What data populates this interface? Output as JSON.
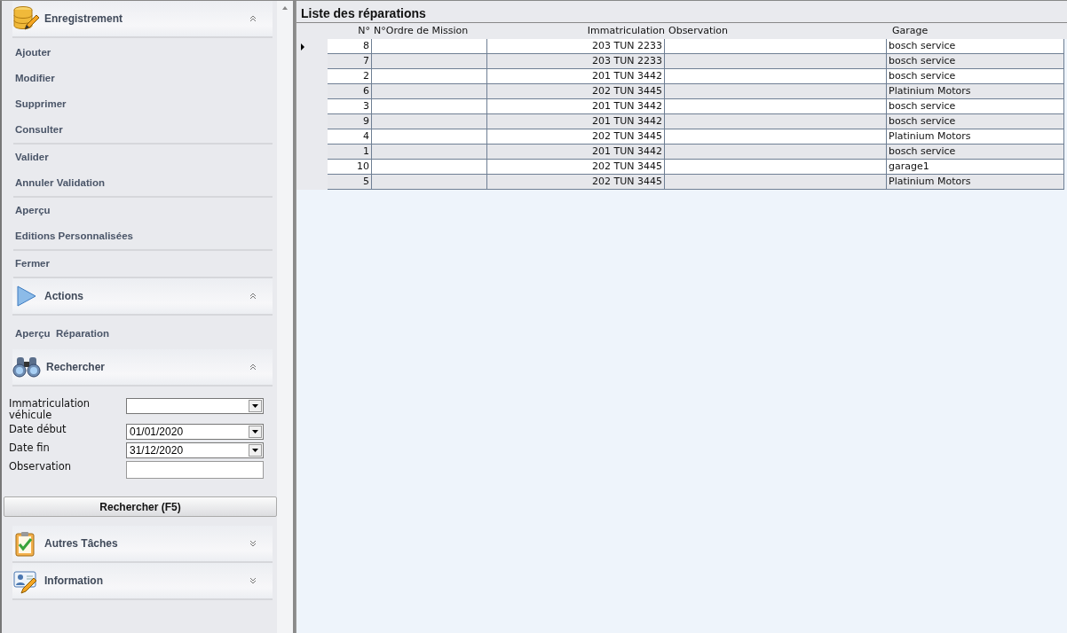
{
  "sidebar": {
    "sections": [
      {
        "title": "Enregistrement",
        "expanded": true,
        "item_groups": [
          [
            "Ajouter",
            "Modifier",
            "Supprimer",
            "Consulter"
          ],
          [
            "Valider",
            "Annuler Validation"
          ],
          [
            "Aperçu",
            "Editions Personnalisées"
          ],
          [
            "Fermer"
          ]
        ]
      },
      {
        "title": "Actions",
        "expanded": true,
        "item_groups": [
          [
            "Aperçu  Réparation"
          ]
        ]
      },
      {
        "title": "Rechercher",
        "expanded": true,
        "form": {
          "fields": [
            {
              "label": "Immatriculation véhicule",
              "kind": "combo"
            },
            {
              "label": "Date début",
              "kind": "combo",
              "value": "01/01/2020"
            },
            {
              "label": "Date fin",
              "kind": "combo",
              "value": "31/12/2020"
            },
            {
              "label": "Observation",
              "kind": "text"
            }
          ],
          "button": "Rechercher (F5)"
        }
      },
      {
        "title": "Autres Tâches",
        "expanded": false
      },
      {
        "title": "Information",
        "expanded": false
      }
    ]
  },
  "table": {
    "title": "Liste des réparations",
    "columns": [
      "N°",
      "N°Ordre de Mission",
      "Immatriculation",
      "Observation",
      "Garage"
    ],
    "rows": [
      {
        "selected": true,
        "cells": [
          "8",
          "",
          "203 TUN 2233",
          "",
          "bosch service"
        ]
      },
      {
        "selected": false,
        "cells": [
          "7",
          "",
          "203 TUN 2233",
          "",
          "bosch service"
        ]
      },
      {
        "selected": false,
        "cells": [
          "2",
          "",
          "201 TUN 3442",
          "",
          "bosch service"
        ]
      },
      {
        "selected": false,
        "cells": [
          "6",
          "",
          "202 TUN 3445",
          "",
          "Platinium Motors"
        ]
      },
      {
        "selected": false,
        "cells": [
          "3",
          "",
          "201 TUN 3442",
          "",
          "bosch service"
        ]
      },
      {
        "selected": false,
        "cells": [
          "9",
          "",
          "201 TUN 3442",
          "",
          "bosch service"
        ]
      },
      {
        "selected": false,
        "cells": [
          "4",
          "",
          "202 TUN 3445",
          "",
          "Platinium Motors"
        ]
      },
      {
        "selected": false,
        "cells": [
          "1",
          "",
          "201 TUN 3442",
          "",
          "bosch service"
        ]
      },
      {
        "selected": false,
        "cells": [
          "10",
          "",
          "202 TUN 3445",
          "",
          "garage1"
        ]
      },
      {
        "selected": false,
        "cells": [
          "5",
          "",
          "202 TUN 3445",
          "",
          "Platinium Motors"
        ]
      }
    ]
  }
}
